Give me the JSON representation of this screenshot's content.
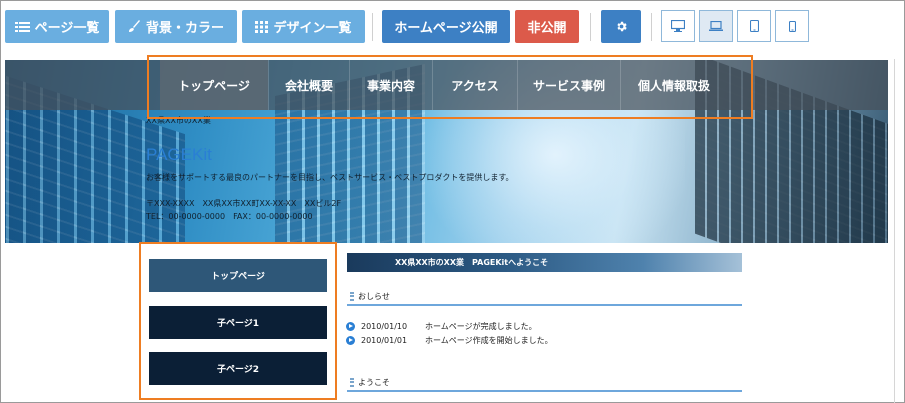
{
  "toolbar": {
    "page_list": "ページ一覧",
    "background_color": "背景・カラー",
    "design_list": "デザイン一覧",
    "publish": "ホームページ公開",
    "unpublish": "非公開",
    "settings_icon": "gear-icon",
    "devices": [
      "desktop-icon",
      "laptop-icon",
      "tablet-icon",
      "smartphone-icon"
    ],
    "active_device": "laptop"
  },
  "header": {
    "nav": [
      "トップページ",
      "会社概要",
      "事業内容",
      "アクセス",
      "サービス事例",
      "個人情報取扱"
    ],
    "active_nav": "トップページ",
    "location": "XX県XX市のXX業",
    "logo": "PAGEKit",
    "tagline": "お客様をサポートする最良のパートナーを目指し、ベストサービス・ベストプロダクトを提供します。",
    "address": "〒XXX-XXXX　XX県XX市XX町XX-XX-XX　XXビル2F",
    "phone": "TEL：00-0000-0000　FAX：00-0000-0000"
  },
  "sidebar": {
    "items": [
      "トップページ",
      "子ページ1",
      "子ページ2"
    ]
  },
  "main": {
    "title": "XX県XX市のXX業　PAGEKitへようこそ",
    "news_heading": "おしらせ",
    "news": [
      {
        "date": "2010/01/10",
        "text": "ホームページが完成しました。"
      },
      {
        "date": "2010/01/01",
        "text": "ホームページ作成を開始しました。"
      }
    ],
    "welcome_heading": "ようこそ"
  },
  "colors": {
    "toolbar_light": "#6aaee0",
    "toolbar_dark": "#3d80c4",
    "unpublish_red": "#dc5a4a",
    "highlight_orange": "#ee7d22",
    "sidebar_active": "#2e5778",
    "sidebar_dark": "#0b1f36"
  }
}
